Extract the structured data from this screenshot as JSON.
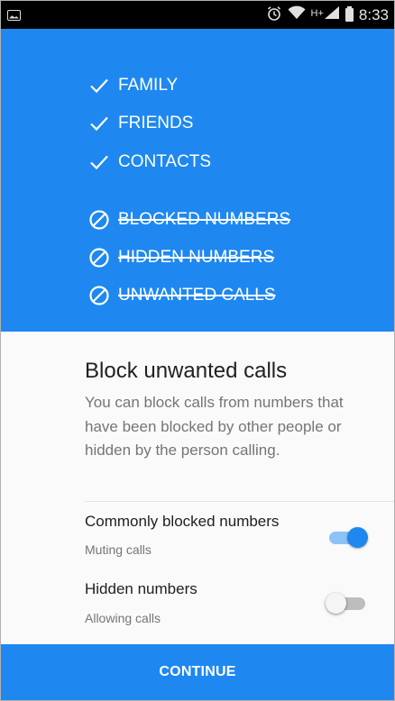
{
  "status_bar": {
    "time": "8:33",
    "network_label": "H+",
    "icons": [
      "image-notification-icon",
      "alarm-icon",
      "wifi-icon",
      "signal-icon",
      "battery-icon"
    ]
  },
  "hero": {
    "allowed": [
      "FAMILY",
      "FRIENDS",
      "CONTACTS"
    ],
    "blocked": [
      "BLOCKED NUMBERS",
      "HIDDEN NUMBERS",
      "UNWANTED CALLS"
    ]
  },
  "content": {
    "title": "Block unwanted calls",
    "description": "You can block calls from numbers that have been blocked by other people or hidden by the person calling."
  },
  "settings": [
    {
      "title": "Commonly blocked numbers",
      "status": "Muting calls",
      "enabled": true
    },
    {
      "title": "Hidden numbers",
      "status": "Allowing calls",
      "enabled": false
    }
  ],
  "continue_label": "CONTINUE",
  "colors": {
    "primary": "#1e88f0",
    "switch_on_track": "#8cc3f7",
    "text_primary": "#212121",
    "text_secondary": "#757575"
  }
}
